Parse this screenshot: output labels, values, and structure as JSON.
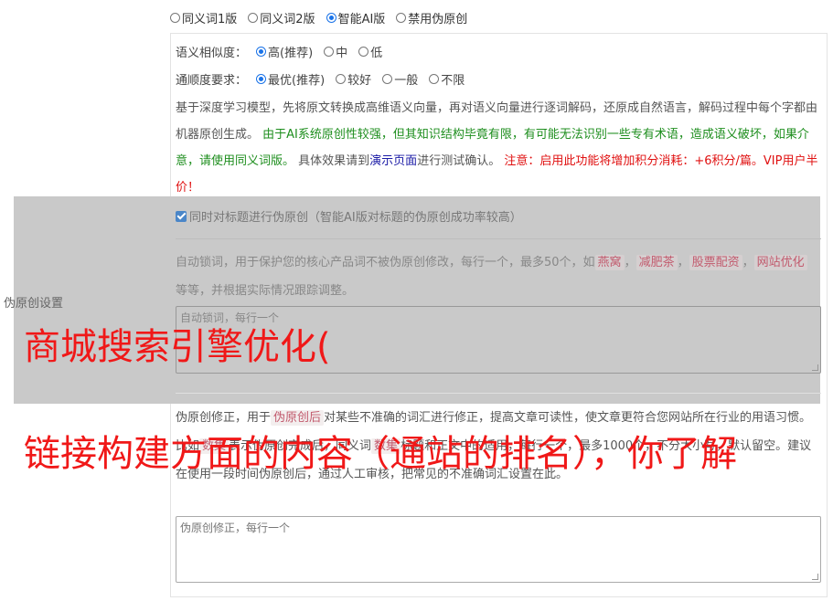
{
  "versions": {
    "options": [
      "同义词1版",
      "同义词2版",
      "智能AI版",
      "禁用伪原创"
    ],
    "selected_index": 2
  },
  "similarity": {
    "label": "语义相似度：",
    "options": [
      "高(推荐)",
      "中",
      "低"
    ],
    "selected_index": 0
  },
  "fluency": {
    "label": "通顺度要求：",
    "options": [
      "最优(推荐)",
      "较好",
      "一般",
      "不限"
    ],
    "selected_index": 0
  },
  "description": {
    "part1": "基于深度学习模型，先将原文转换成高维语义向量，再对语义向量进行逐词解码，还原成自然语言，解码过程中每个字都由机器原创生成。",
    "green_text": "由于AI系统原创性较强，但其知识结构毕竟有限，有可能无法识别一些专有术语，造成语义破坏，如果介意，请使用同义词版。",
    "part2": "具体效果请到",
    "demo_link": "演示页面",
    "part3": "进行测试确认。",
    "red_text": "注意：启用此功能将增加积分消耗：+6积分/篇。VIP用户半价！"
  },
  "title_checkbox": {
    "label": "同时对标题进行伪原创（智能AI版对标题的伪原创成功率较高）",
    "checked": true
  },
  "lock_words": {
    "desc_before": "自动锁词，用于保护您的核心产品词不被伪原创修改，每行一个，最多50个，如",
    "examples": [
      "燕窝",
      "减肥茶",
      "股票配资",
      "网站优化"
    ],
    "separator": "，",
    "desc_after": "等等，并根据实际情况跟踪调整。",
    "placeholder": "自动锁词，每行一个"
  },
  "side_label": "伪原创设置",
  "correction": {
    "desc_before": "伪原创修正，用于",
    "tag": "伪原创后",
    "desc_middle": "对某些不准确的词汇进行修正，提高文章可读性，使文章更符合您网站所在行业的用语习惯。比如",
    "tag2": "数集",
    "desc_middle2": "表示伪原创完成后，同义词",
    "tag3": "数集",
    "desc_after": "标题和正文中的适用，每行一个，最多1000个，不分大小写，默认留空。建议在使用一段时间伪原创后，通过人工审核，把常见的不准确词汇设置在此。",
    "placeholder": "伪原创修正，每行一个"
  },
  "overlay": {
    "line1": "商城搜索引擎优化(",
    "line2": "链接构建方面的内容（通站的排名），你了解"
  }
}
